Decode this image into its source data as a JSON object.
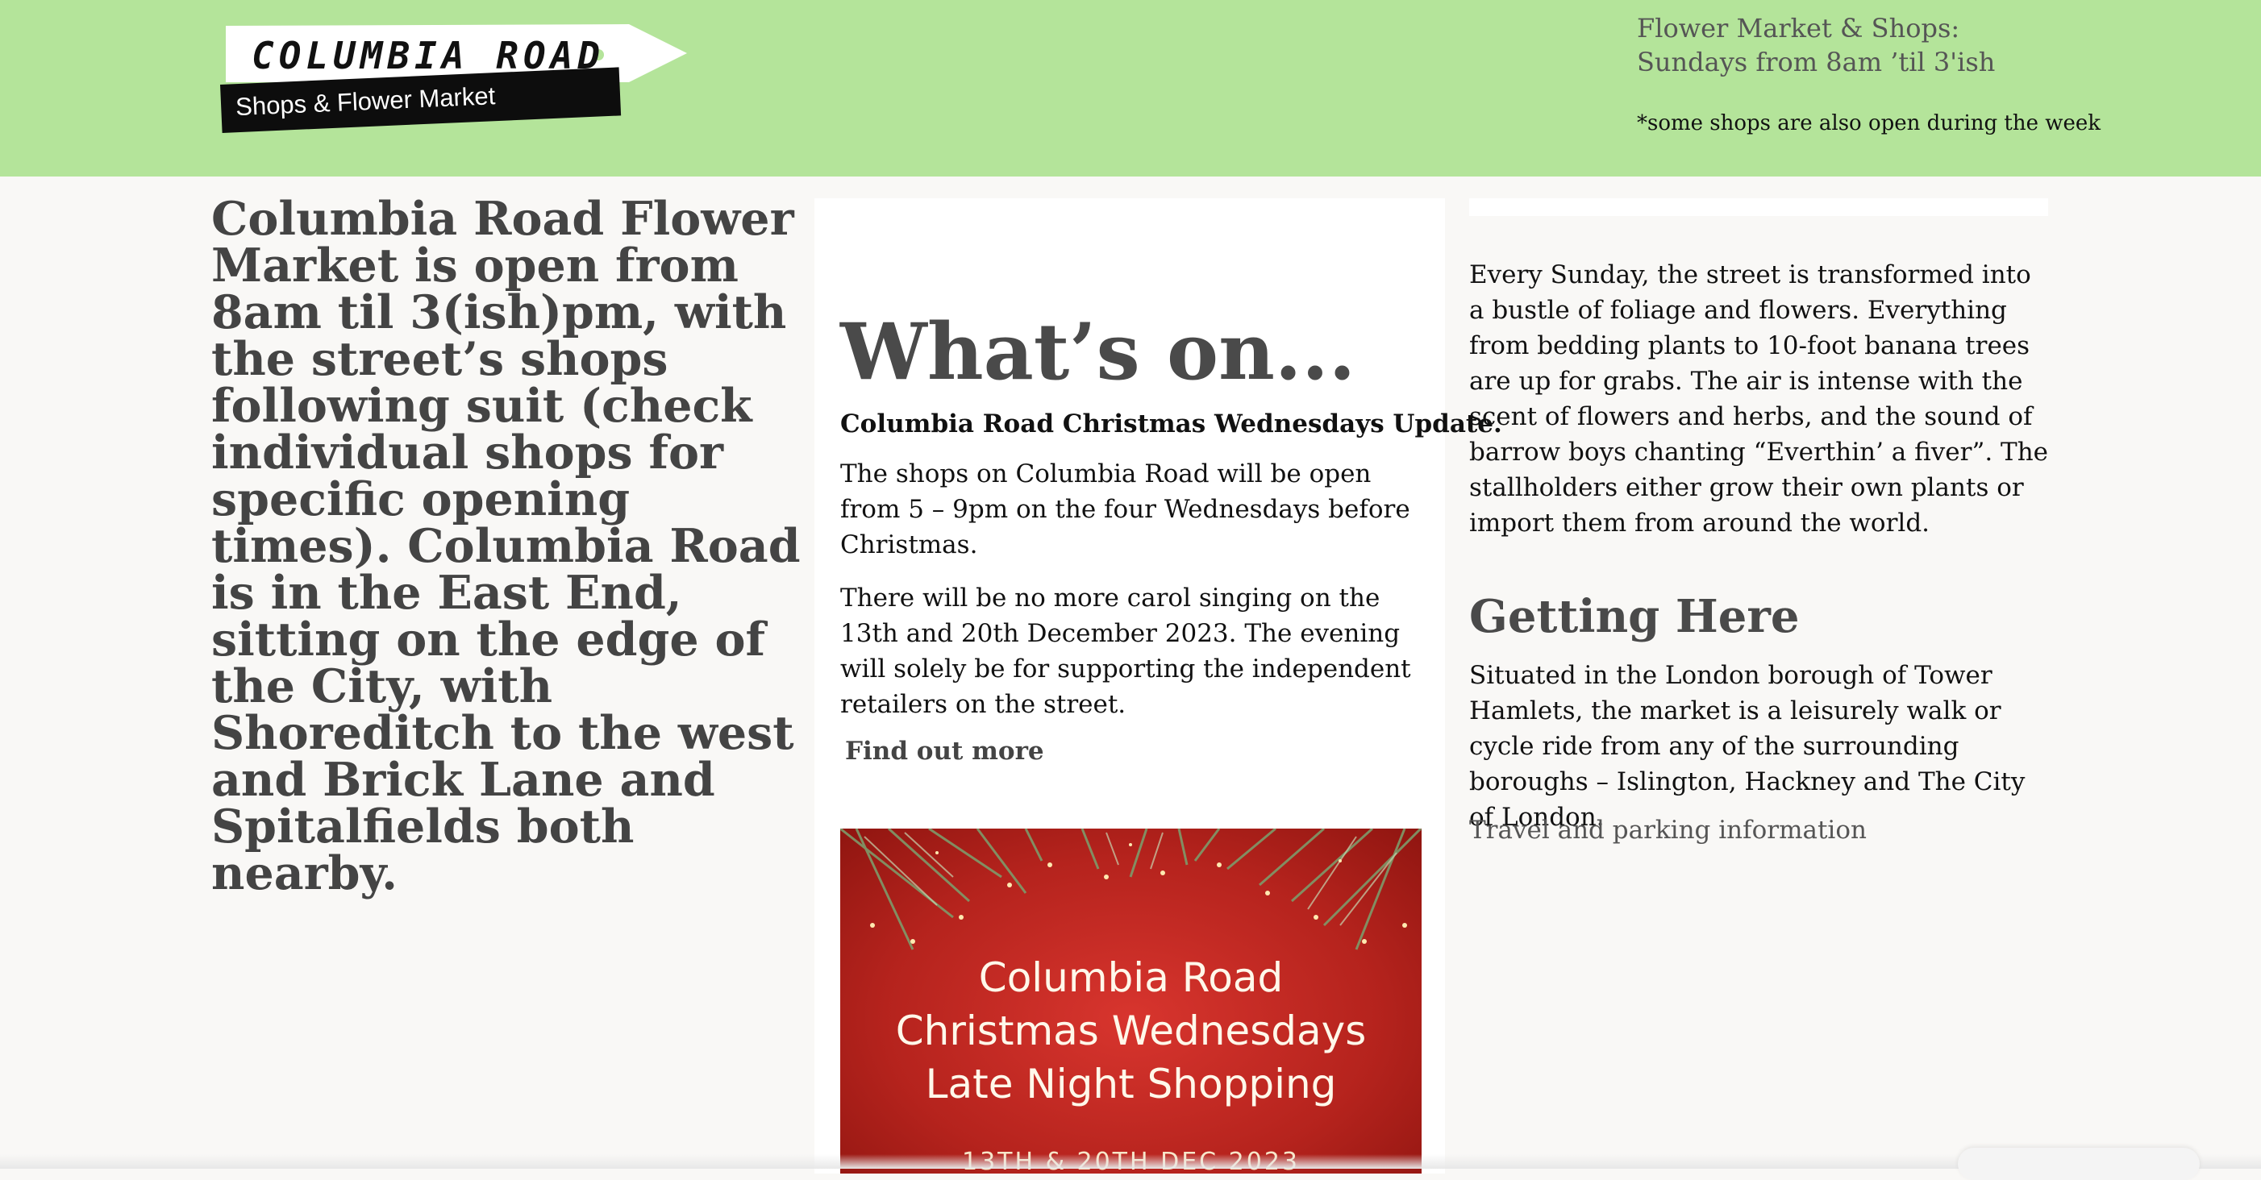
{
  "header": {
    "logo_top": "COLUMBIA ROAD",
    "logo_bottom": "Shops & Flower Market",
    "hours_line1": "Flower Market & Shops:",
    "hours_line2": "Sundays from 8am ’til 3'ish",
    "hours_note": "*some shops are also open during the week",
    "colors": {
      "header_bg": "#b4e49a",
      "sign_dark": "#0d0d0d"
    }
  },
  "intro": {
    "text": "Columbia Road Flower Market is open from 8am til 3(ish)pm, with the street’s shops following suit (check individual shops for specific opening times). Columbia Road is in the East End, sitting on the edge of the City, with Shoreditch to the west and Brick Lane and Spitalfields both nearby."
  },
  "whats_on": {
    "heading": "What’s on...",
    "update_title": "Columbia Road Christmas Wednesdays Update.",
    "para1": "The shops on Columbia Road will be open from 5 – 9pm on the four Wednesdays before Christmas.",
    "para2": "There will be no more carol singing on the 13th and 20th December 2023. The evening will solely be for supporting the independent retailers on the street.",
    "find_more": "Find out more",
    "poster": {
      "line1": "Columbia Road",
      "line2": "Christmas Wednesdays",
      "line3": "Late Night Shopping",
      "date": "13TH & 20TH DEC 2023"
    }
  },
  "about": {
    "para": "Every Sunday, the street is transformed into a bustle of foliage and flowers. Everything from bedding plants to 10-foot banana trees are up for grabs. The air is intense with the scent of flowers and herbs,  and the sound of barrow boys chanting “Everthin’ a fiver”.  The stallholders either grow their own plants or import them from around the world.",
    "getting_here_heading": "Getting Here",
    "getting_here_para": "Situated in the London borough of Tower Hamlets, the market is a leisurely walk or cycle ride from any of the surrounding boroughs – Islington, Hackney and The City of London.",
    "travel_link": "Travel and parking information"
  }
}
